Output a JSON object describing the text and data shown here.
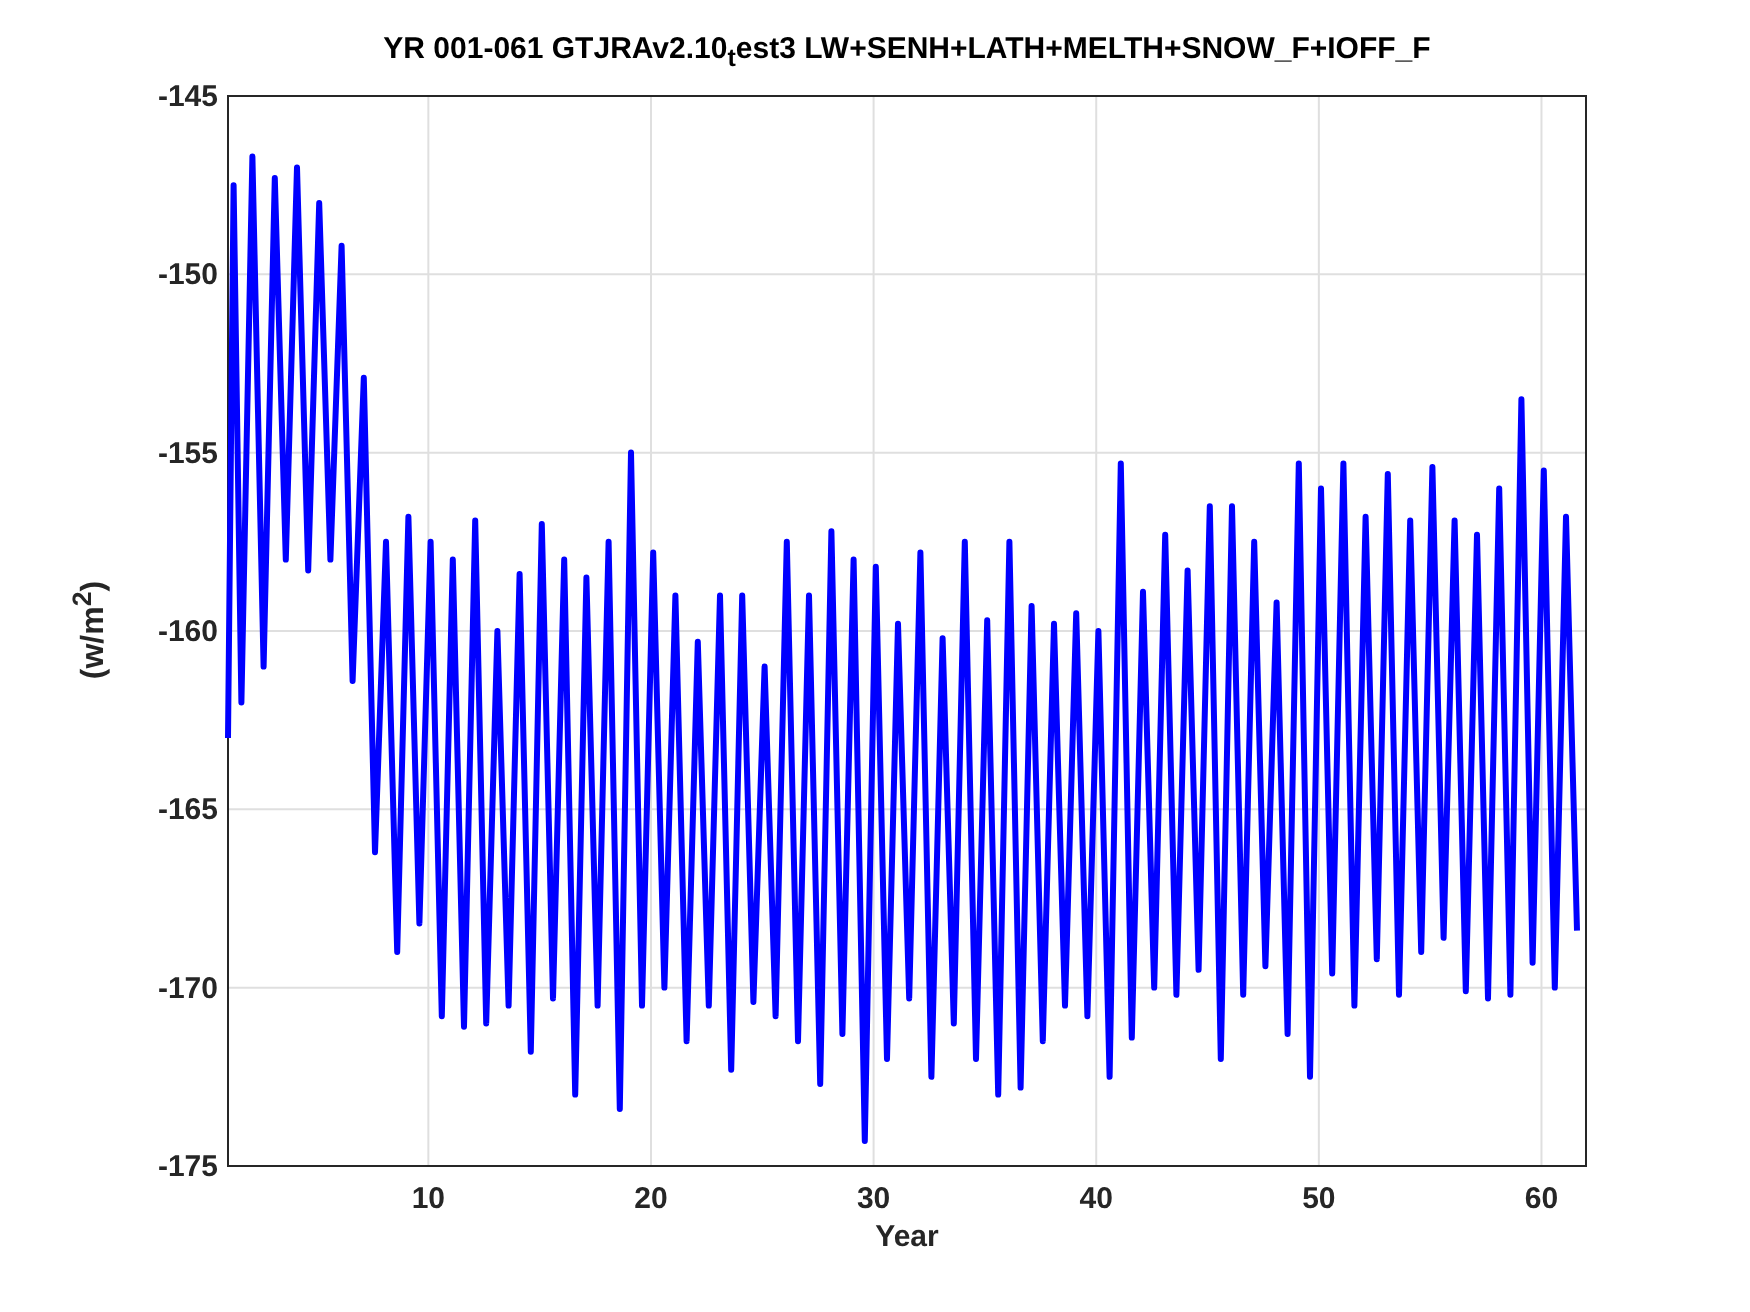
{
  "chart": {
    "chart_data": {
      "type": "line",
      "title": "YR 001-061 GTJRAv2.10$_{t}$est3 LW+SENH+LATH+MELTH+SNOW_F+IOFF_F",
      "ylabel": "(w/m$^{2}$)",
      "xlabel": "Year",
      "xlim": [
        1,
        62
      ],
      "ylim": [
        -175,
        -145
      ],
      "xticks": [
        10,
        20,
        30,
        40,
        50,
        60
      ],
      "yticks": [
        -175,
        -170,
        -165,
        -160,
        -155,
        -150,
        -145
      ],
      "grid": true,
      "x": [
        1.0,
        1.25,
        1.6,
        2.1,
        2.6,
        3.1,
        3.6,
        4.1,
        4.6,
        5.1,
        5.6,
        6.1,
        6.6,
        7.1,
        7.6,
        8.1,
        8.6,
        9.1,
        9.6,
        10.1,
        10.6,
        11.1,
        11.6,
        12.1,
        12.6,
        13.1,
        13.6,
        14.1,
        14.6,
        15.1,
        15.6,
        16.1,
        16.6,
        17.1,
        17.6,
        18.1,
        18.6,
        19.1,
        19.6,
        20.1,
        20.6,
        21.1,
        21.6,
        22.1,
        22.6,
        23.1,
        23.6,
        24.1,
        24.6,
        25.1,
        25.6,
        26.1,
        26.6,
        27.1,
        27.6,
        28.1,
        28.6,
        29.1,
        29.6,
        30.1,
        30.6,
        31.1,
        31.6,
        32.1,
        32.6,
        33.1,
        33.6,
        34.1,
        34.6,
        35.1,
        35.6,
        36.1,
        36.6,
        37.1,
        37.6,
        38.1,
        38.6,
        39.1,
        39.6,
        40.1,
        40.6,
        41.1,
        41.6,
        42.1,
        42.6,
        43.1,
        43.6,
        44.1,
        44.6,
        45.1,
        45.6,
        46.1,
        46.6,
        47.1,
        47.6,
        48.1,
        48.6,
        49.1,
        49.6,
        50.1,
        50.6,
        51.1,
        51.6,
        52.1,
        52.6,
        53.1,
        53.6,
        54.1,
        54.6,
        55.1,
        55.6,
        56.1,
        56.6,
        57.1,
        57.6,
        58.1,
        58.6,
        59.1,
        59.6,
        60.1,
        60.6,
        61.1,
        61.6
      ],
      "series": [
        {
          "color": "#0000ff",
          "values": [
            -163,
            -147.5,
            -162,
            -146.7,
            -161,
            -147.3,
            -158,
            -147,
            -158.3,
            -148,
            -158,
            -149.2,
            -161.4,
            -152.9,
            -166.2,
            -157.5,
            -169,
            -156.8,
            -168.2,
            -157.5,
            -170.8,
            -158,
            -171.1,
            -156.9,
            -171,
            -160,
            -170.5,
            -158.4,
            -171.8,
            -157,
            -170.3,
            -158,
            -173,
            -158.5,
            -170.5,
            -157.5,
            -173.4,
            -155,
            -170.5,
            -157.8,
            -170,
            -159,
            -171.5,
            -160.3,
            -170.5,
            -159,
            -172.3,
            -159,
            -170.4,
            -161,
            -170.8,
            -157.5,
            -171.5,
            -159,
            -172.7,
            -157.2,
            -171.3,
            -158,
            -174.3,
            -158.2,
            -172,
            -159.8,
            -170.3,
            -157.8,
            -172.5,
            -160.2,
            -171,
            -157.5,
            -172,
            -159.7,
            -173,
            -157.5,
            -172.8,
            -159.3,
            -171.5,
            -159.8,
            -170.5,
            -159.5,
            -170.8,
            -160,
            -172.5,
            -155.3,
            -171.4,
            -158.9,
            -170,
            -157.3,
            -170.2,
            -158.3,
            -169.5,
            -156.5,
            -172,
            -156.5,
            -170.2,
            -157.5,
            -169.4,
            -159.2,
            -171.3,
            -155.3,
            -172.5,
            -156,
            -169.6,
            -155.3,
            -170.5,
            -156.8,
            -169.2,
            -155.6,
            -170.2,
            -156.9,
            -169,
            -155.4,
            -168.6,
            -156.9,
            -170.1,
            -157.3,
            -170.3,
            -156,
            -170.2,
            -153.5,
            -169.3,
            -155.5,
            -170,
            -156.8,
            -168.4
          ]
        }
      ]
    }
  }
}
